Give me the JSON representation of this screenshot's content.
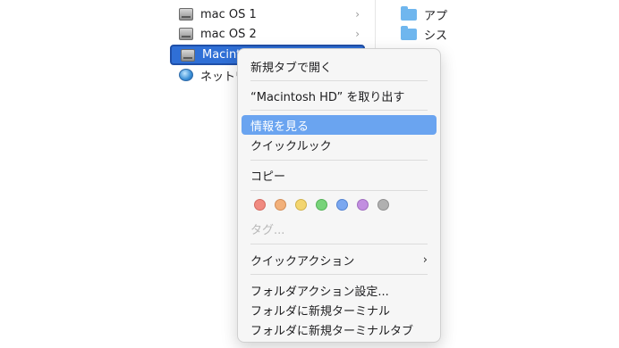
{
  "sidebar": {
    "items": [
      {
        "label": "mac OS 1",
        "icon": "drive-icon"
      },
      {
        "label": "mac OS 2",
        "icon": "drive-icon"
      },
      {
        "label": "Macinto",
        "icon": "drive-icon",
        "selected": true
      },
      {
        "label": "ネットワ",
        "icon": "network-globe-icon"
      }
    ]
  },
  "right_column": {
    "items": [
      {
        "label": "アプ",
        "icon": "folder-icon"
      },
      {
        "label": "シス",
        "icon": "folder-icon"
      }
    ]
  },
  "context_menu": {
    "open_new_tab": "新規タブで開く",
    "eject": "“Macintosh HD” を取り出す",
    "get_info": "情報を見る",
    "quick_look": "クイックルック",
    "copy": "コピー",
    "tags_label": "タグ...",
    "quick_actions": "クイックアクション",
    "folder_action_settings": "フォルダアクション設定...",
    "new_terminal_at_folder": "フォルダに新規ターミナル",
    "new_terminal_tab_at_folder": "フォルダに新規ターミナルタブ",
    "tag_colors": [
      "#f08a80",
      "#f2b07a",
      "#f3d56f",
      "#78d37a",
      "#7aa7f0",
      "#c28ee0",
      "#b0b0b0"
    ],
    "tag_borders": [
      "#d36a60",
      "#d38e58",
      "#d0b24c",
      "#55b258",
      "#5584d1",
      "#a06dbf",
      "#8f8f8f"
    ]
  },
  "colors": {
    "selection": "#2f6fd6",
    "menu_highlight": "#6aa4f0"
  }
}
